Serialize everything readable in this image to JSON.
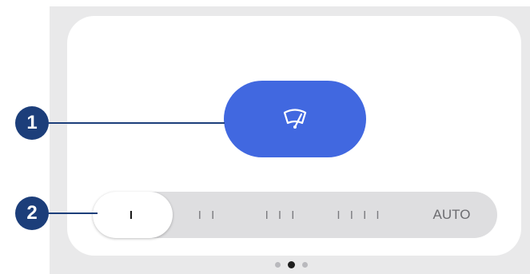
{
  "wiper_button": {
    "icon": "windshield-wiper-icon",
    "color": "#4168e0"
  },
  "speed_selector": {
    "selected_index": 0,
    "options": [
      {
        "label": "I"
      },
      {
        "label": "I I"
      },
      {
        "label": "I I I"
      },
      {
        "label": "I I I I"
      },
      {
        "label": "AUTO"
      }
    ]
  },
  "callouts": [
    {
      "number": "1"
    },
    {
      "number": "2"
    }
  ],
  "pagination": {
    "total": 3,
    "active_index": 1
  },
  "colors": {
    "callout": "#1c3e7a",
    "track": "#dedee0",
    "background": "#e9e9ea"
  }
}
